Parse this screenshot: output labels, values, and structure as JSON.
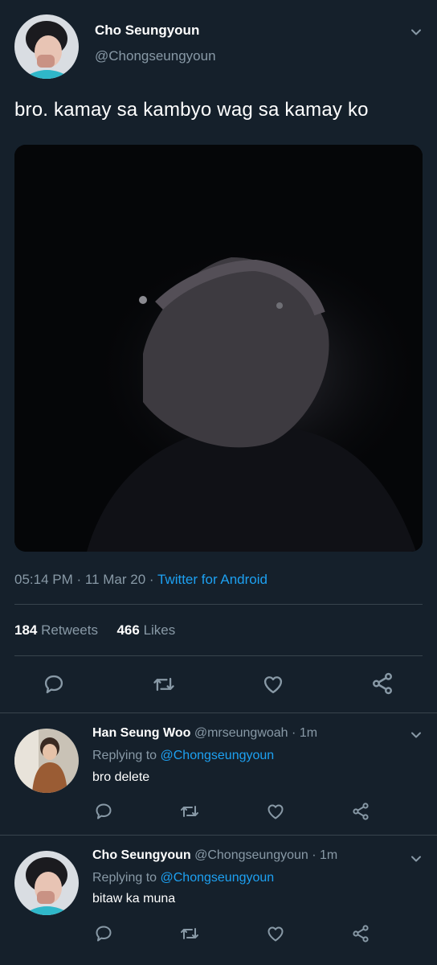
{
  "tweet": {
    "author_name": "Cho Seungyoun",
    "author_handle": "@Chongseungyoun",
    "text": "bro. kamay sa kambyo wag sa kamay ko",
    "time": "05:14 PM",
    "date": "11 Mar 20",
    "source": "Twitter for Android",
    "retweets_count": "184",
    "retweets_label": "Retweets",
    "likes_count": "466",
    "likes_label": "Likes"
  },
  "replies": [
    {
      "name": "Han Seung Woo",
      "handle": "@mrseungwoah",
      "age": "1m",
      "replying_to_label": "Replying to",
      "replying_to": "@Chongseungyoun",
      "text": "bro delete"
    },
    {
      "name": "Cho Seungyoun",
      "handle": "@Chongseungyoun",
      "age": "1m",
      "replying_to_label": "Replying to",
      "replying_to": "@Chongseungyoun",
      "text": "bitaw ka muna"
    }
  ],
  "colors": {
    "background": "#15202b",
    "accent": "#1da1f2",
    "muted": "#8899a6",
    "divider": "#38444d"
  },
  "icons": [
    "chevron-down-icon",
    "reply-icon",
    "retweet-icon",
    "like-icon",
    "share-icon"
  ]
}
